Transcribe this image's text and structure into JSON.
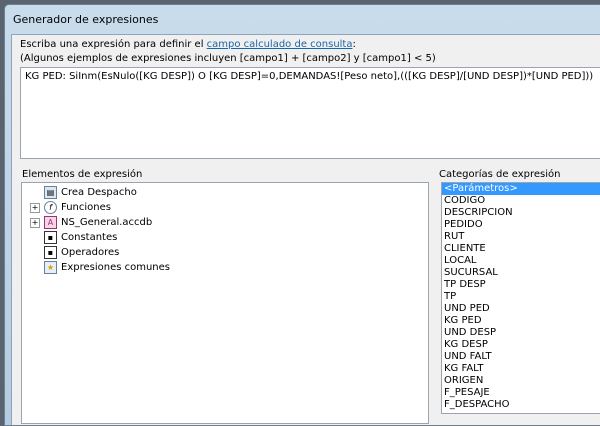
{
  "window": {
    "title": "Generador de expresiones"
  },
  "instructions": {
    "prefix": "Escriba una expresión para definir el ",
    "link": "campo calculado de consulta",
    "suffix": ":",
    "examples": "(Algunos ejemplos de expresiones incluyen [campo1] + [campo2] y [campo1] < 5)"
  },
  "expression": {
    "value": "KG PED: SiInm(EsNulo([KG DESP]) O [KG DESP]=0,DEMANDAS![Peso neto],(([KG DESP]/[UND DESP])*[UND PED]))"
  },
  "elements": {
    "label": "Elementos de expresión",
    "items": [
      {
        "label": "Crea Despacho",
        "icon": "form-icon",
        "expandable": false
      },
      {
        "label": "Funciones",
        "icon": "function-icon",
        "expandable": true
      },
      {
        "label": "NS_General.accdb",
        "icon": "access-database-icon",
        "expandable": true
      },
      {
        "label": "Constantes",
        "icon": "constants-icon",
        "expandable": false
      },
      {
        "label": "Operadores",
        "icon": "operators-icon",
        "expandable": false
      },
      {
        "label": "Expresiones comunes",
        "icon": "common-expressions-icon",
        "expandable": false
      }
    ]
  },
  "categories": {
    "label": "Categorías de expresión",
    "selected": "<Parámetros>",
    "items": [
      "<Parámetros>",
      "CODIGO",
      "DESCRIPCION",
      "PEDIDO",
      "RUT",
      "CLIENTE",
      "LOCAL",
      "SUCURSAL",
      "TP DESP",
      "TP",
      "UND PED",
      "KG PED",
      "UND DESP",
      "KG DESP",
      "UND FALT",
      "KG FALT",
      "ORIGEN",
      "F_PESAJE",
      "F_DESPACHO"
    ]
  }
}
